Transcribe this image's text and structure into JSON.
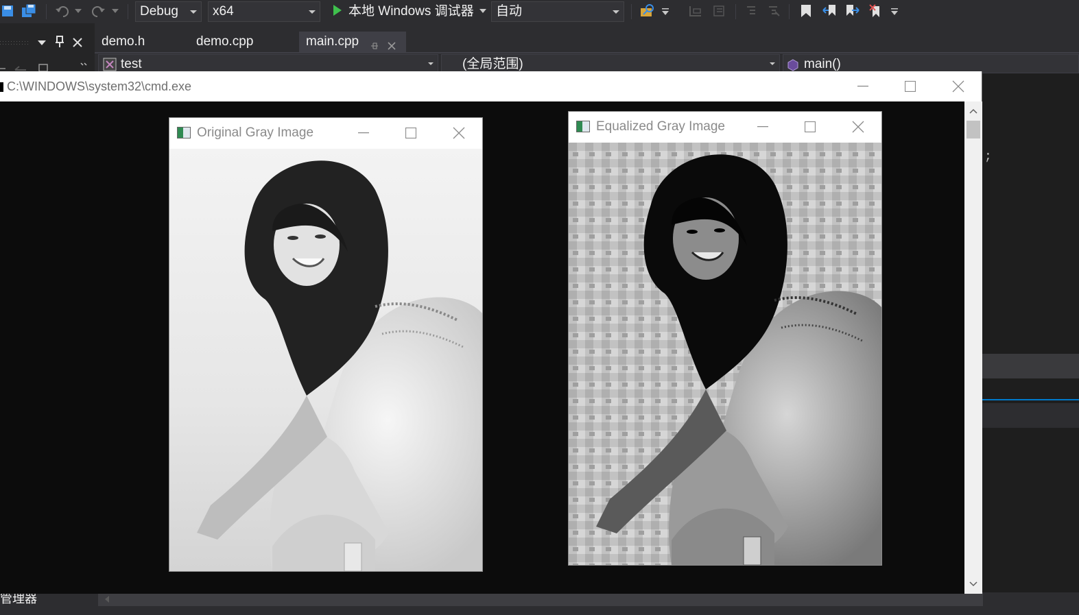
{
  "toolbar": {
    "config": "Debug",
    "platform": "x64",
    "run_label": "本地 Windows 调试器",
    "target": "自动"
  },
  "tabs": [
    {
      "label": "demo.h"
    },
    {
      "label": "demo.cpp"
    },
    {
      "label": "main.cpp"
    }
  ],
  "nav": {
    "project": "test",
    "scope": "(全局范围)",
    "member": "main()"
  },
  "bottom": {
    "label": "管理器"
  },
  "cmd": {
    "title": "C:\\WINDOWS\\system32\\cmd.exe"
  },
  "windows": {
    "original_title": "Original Gray Image",
    "equalized_title": "Equalized Gray Image"
  },
  "colors": {
    "vs_bg": "#2d2d30",
    "console_bg": "#0c0c0c",
    "accent_blue": "#007acc",
    "play_green": "#3fc04d"
  },
  "icons": [
    "save-icon",
    "save-all-icon",
    "undo-icon",
    "redo-icon",
    "find-icon",
    "bookmark-icon",
    "pin-icon",
    "close-icon",
    "minimize-icon",
    "maximize-icon"
  ]
}
